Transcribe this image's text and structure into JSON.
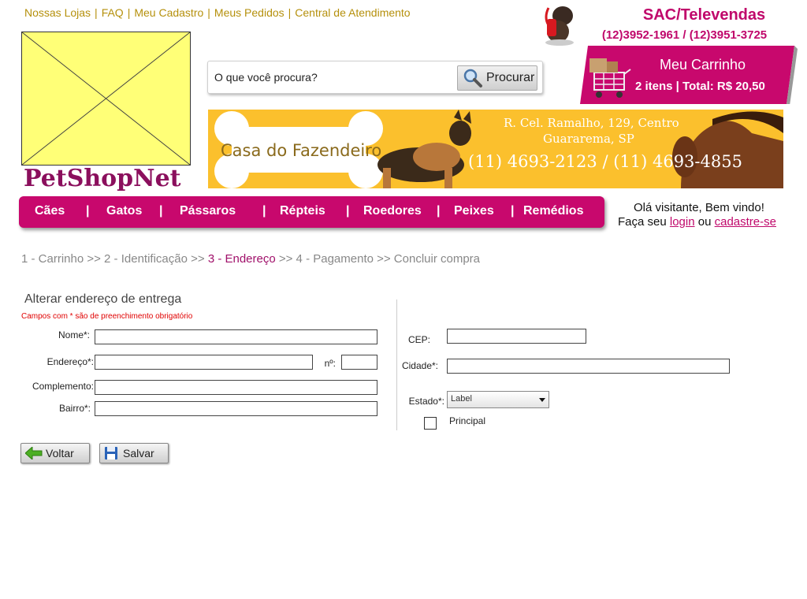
{
  "top_links": [
    "Nossas Lojas",
    "FAQ",
    "Meu Cadastro",
    "Meus Pedidos",
    "Central de Atendimento"
  ],
  "sac": {
    "title": "SAC/Televendas",
    "phones": "(12)3952-1961 / (12)3951-3725"
  },
  "logo": {
    "text": "PetShopNet"
  },
  "search": {
    "placeholder": "O que você procura?",
    "button": "Procurar"
  },
  "cart": {
    "title": "Meu Carrinho",
    "summary": "2 itens | Total: R$ 20,50"
  },
  "banner": {
    "name": "Casa do Fazendeiro",
    "address_line1": "R. Cel. Ramalho, 129, Centro",
    "address_line2": "Guararema, SP",
    "phones": "(11) 4693-2123 / (11) 4693-4855"
  },
  "nav": {
    "items": [
      "Cães",
      "Gatos",
      "Pássaros",
      "Répteis",
      "Roedores",
      "Peixes",
      "Remédios"
    ]
  },
  "welcome": {
    "greeting": "Olá visitante, Bem vindo!",
    "prefix": "Faça seu",
    "login": "login",
    "or": "ou",
    "register": "cadastre-se"
  },
  "steps": {
    "before": "1 - Carrinho >> 2 - Identificação >>",
    "current": "3 - Endereço",
    "after": ">> 4 - Pagamento >> Concluir compra"
  },
  "form": {
    "title": "Alterar  endereço de entrega",
    "required_note": "Campos com * são de preenchimento obrigatório",
    "labels": {
      "nome": "Nome*:",
      "endereco": "Endereço*:",
      "numero": "nº:",
      "complemento": "Complemento:",
      "bairro": "Bairro*:",
      "cep": "CEP:",
      "cidade": "Cidade*:",
      "estado": "Estado*:",
      "principal": "Principal"
    },
    "estado_selected": "Label"
  },
  "buttons": {
    "back": "Voltar",
    "save": "Salvar"
  },
  "colors": {
    "brand": "#c8086d",
    "gold_links": "#b5900c",
    "banner": "#fbc02d",
    "logo_bg": "#ffff77"
  }
}
